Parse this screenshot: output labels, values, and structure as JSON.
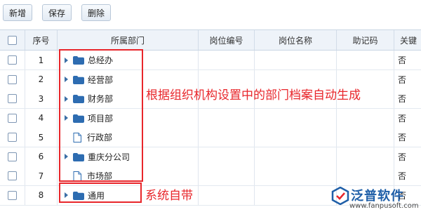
{
  "toolbar": {
    "add_label": "新增",
    "save_label": "保存",
    "delete_label": "删除"
  },
  "columns": {
    "seq": "序号",
    "dept": "所属部门",
    "code": "岗位编号",
    "name": "岗位名称",
    "memo": "助记码",
    "close": "关键"
  },
  "rows": [
    {
      "seq": "1",
      "dept": "总经办",
      "icon": "folder-icon",
      "expandable": true,
      "close": "否"
    },
    {
      "seq": "2",
      "dept": "经营部",
      "icon": "folder-icon",
      "expandable": true,
      "close": "否"
    },
    {
      "seq": "3",
      "dept": "财务部",
      "icon": "folder-icon",
      "expandable": true,
      "close": "否"
    },
    {
      "seq": "4",
      "dept": "项目部",
      "icon": "folder-icon",
      "expandable": true,
      "close": "否"
    },
    {
      "seq": "5",
      "dept": "行政部",
      "icon": "file-icon",
      "expandable": false,
      "close": "否"
    },
    {
      "seq": "6",
      "dept": "重庆分公司",
      "icon": "folder-icon",
      "expandable": true,
      "close": "否"
    },
    {
      "seq": "7",
      "dept": "市场部",
      "icon": "file-icon",
      "expandable": false,
      "close": "否"
    },
    {
      "seq": "8",
      "dept": "通用",
      "icon": "folder-icon",
      "expandable": true,
      "close": "否"
    }
  ],
  "annotations": {
    "dept_archive_note": "根据组织机构设置中的部门档案自动生成",
    "system_note": "系统自带"
  },
  "logo": {
    "name": "泛普软件",
    "url": "www.fanpusoft.com"
  },
  "colors": {
    "accent": "#e8262b",
    "folder": "#2d6cb1",
    "header_bg": "#eef3f9"
  }
}
